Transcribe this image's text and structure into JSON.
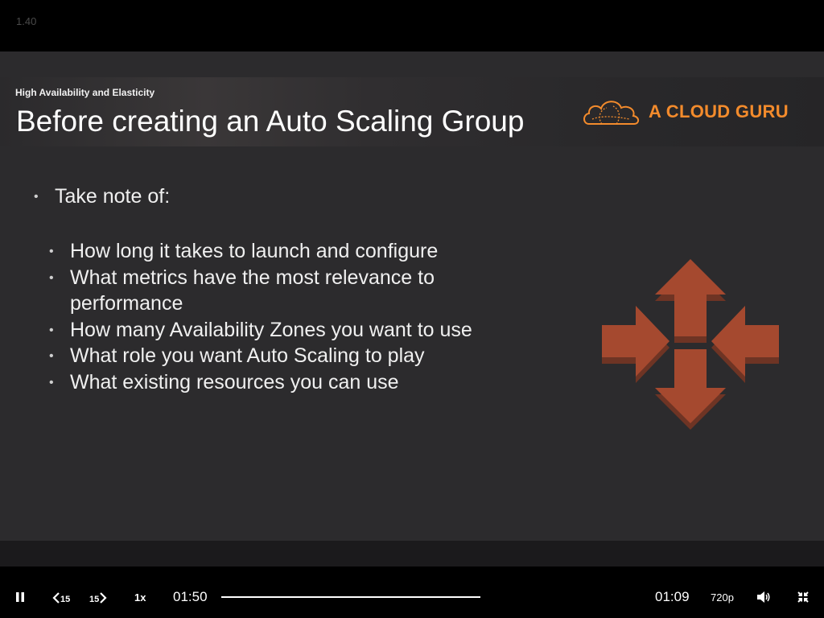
{
  "player": {
    "lesson_number": "1.40",
    "elapsed": "01:50",
    "remaining": "01:09",
    "speed": "1x",
    "quality": "720p",
    "skip_back_label": "15",
    "skip_forward_label": "15",
    "progress_fraction": 1.0
  },
  "slide": {
    "section": "High Availability and Elasticity",
    "title": "Before creating an Auto Scaling Group",
    "brand": "A CLOUD GURU",
    "main_bullet": "Take note of:",
    "sub_bullets": [
      "How long it takes to launch and configure",
      "What metrics have the most relevance to performance",
      "How many Availability Zones you want to use",
      "What role you want Auto Scaling to play",
      "What existing resources you can use"
    ],
    "sub_bullet_lines": [
      [
        "How long it takes to launch and configure"
      ],
      [
        "What metrics have the most relevance to",
        "performance"
      ],
      [
        "How many Availability Zones you want to use"
      ],
      [
        "What role you want Auto Scaling to play"
      ],
      [
        "What existing resources you can use"
      ]
    ]
  },
  "colors": {
    "brand_orange": "#f38b2c",
    "icon_fill": "#a5492f",
    "icon_shadow": "#6e3424",
    "slide_bg": "#2c2b2d"
  },
  "icons": {
    "pause": "pause-icon",
    "skip_back": "rewind-15-icon",
    "skip_forward": "forward-15-icon",
    "volume": "volume-icon",
    "exit_fullscreen": "exit-fullscreen-icon",
    "logo": "cloud-logo-icon",
    "scaling": "auto-scaling-arrows-icon"
  }
}
